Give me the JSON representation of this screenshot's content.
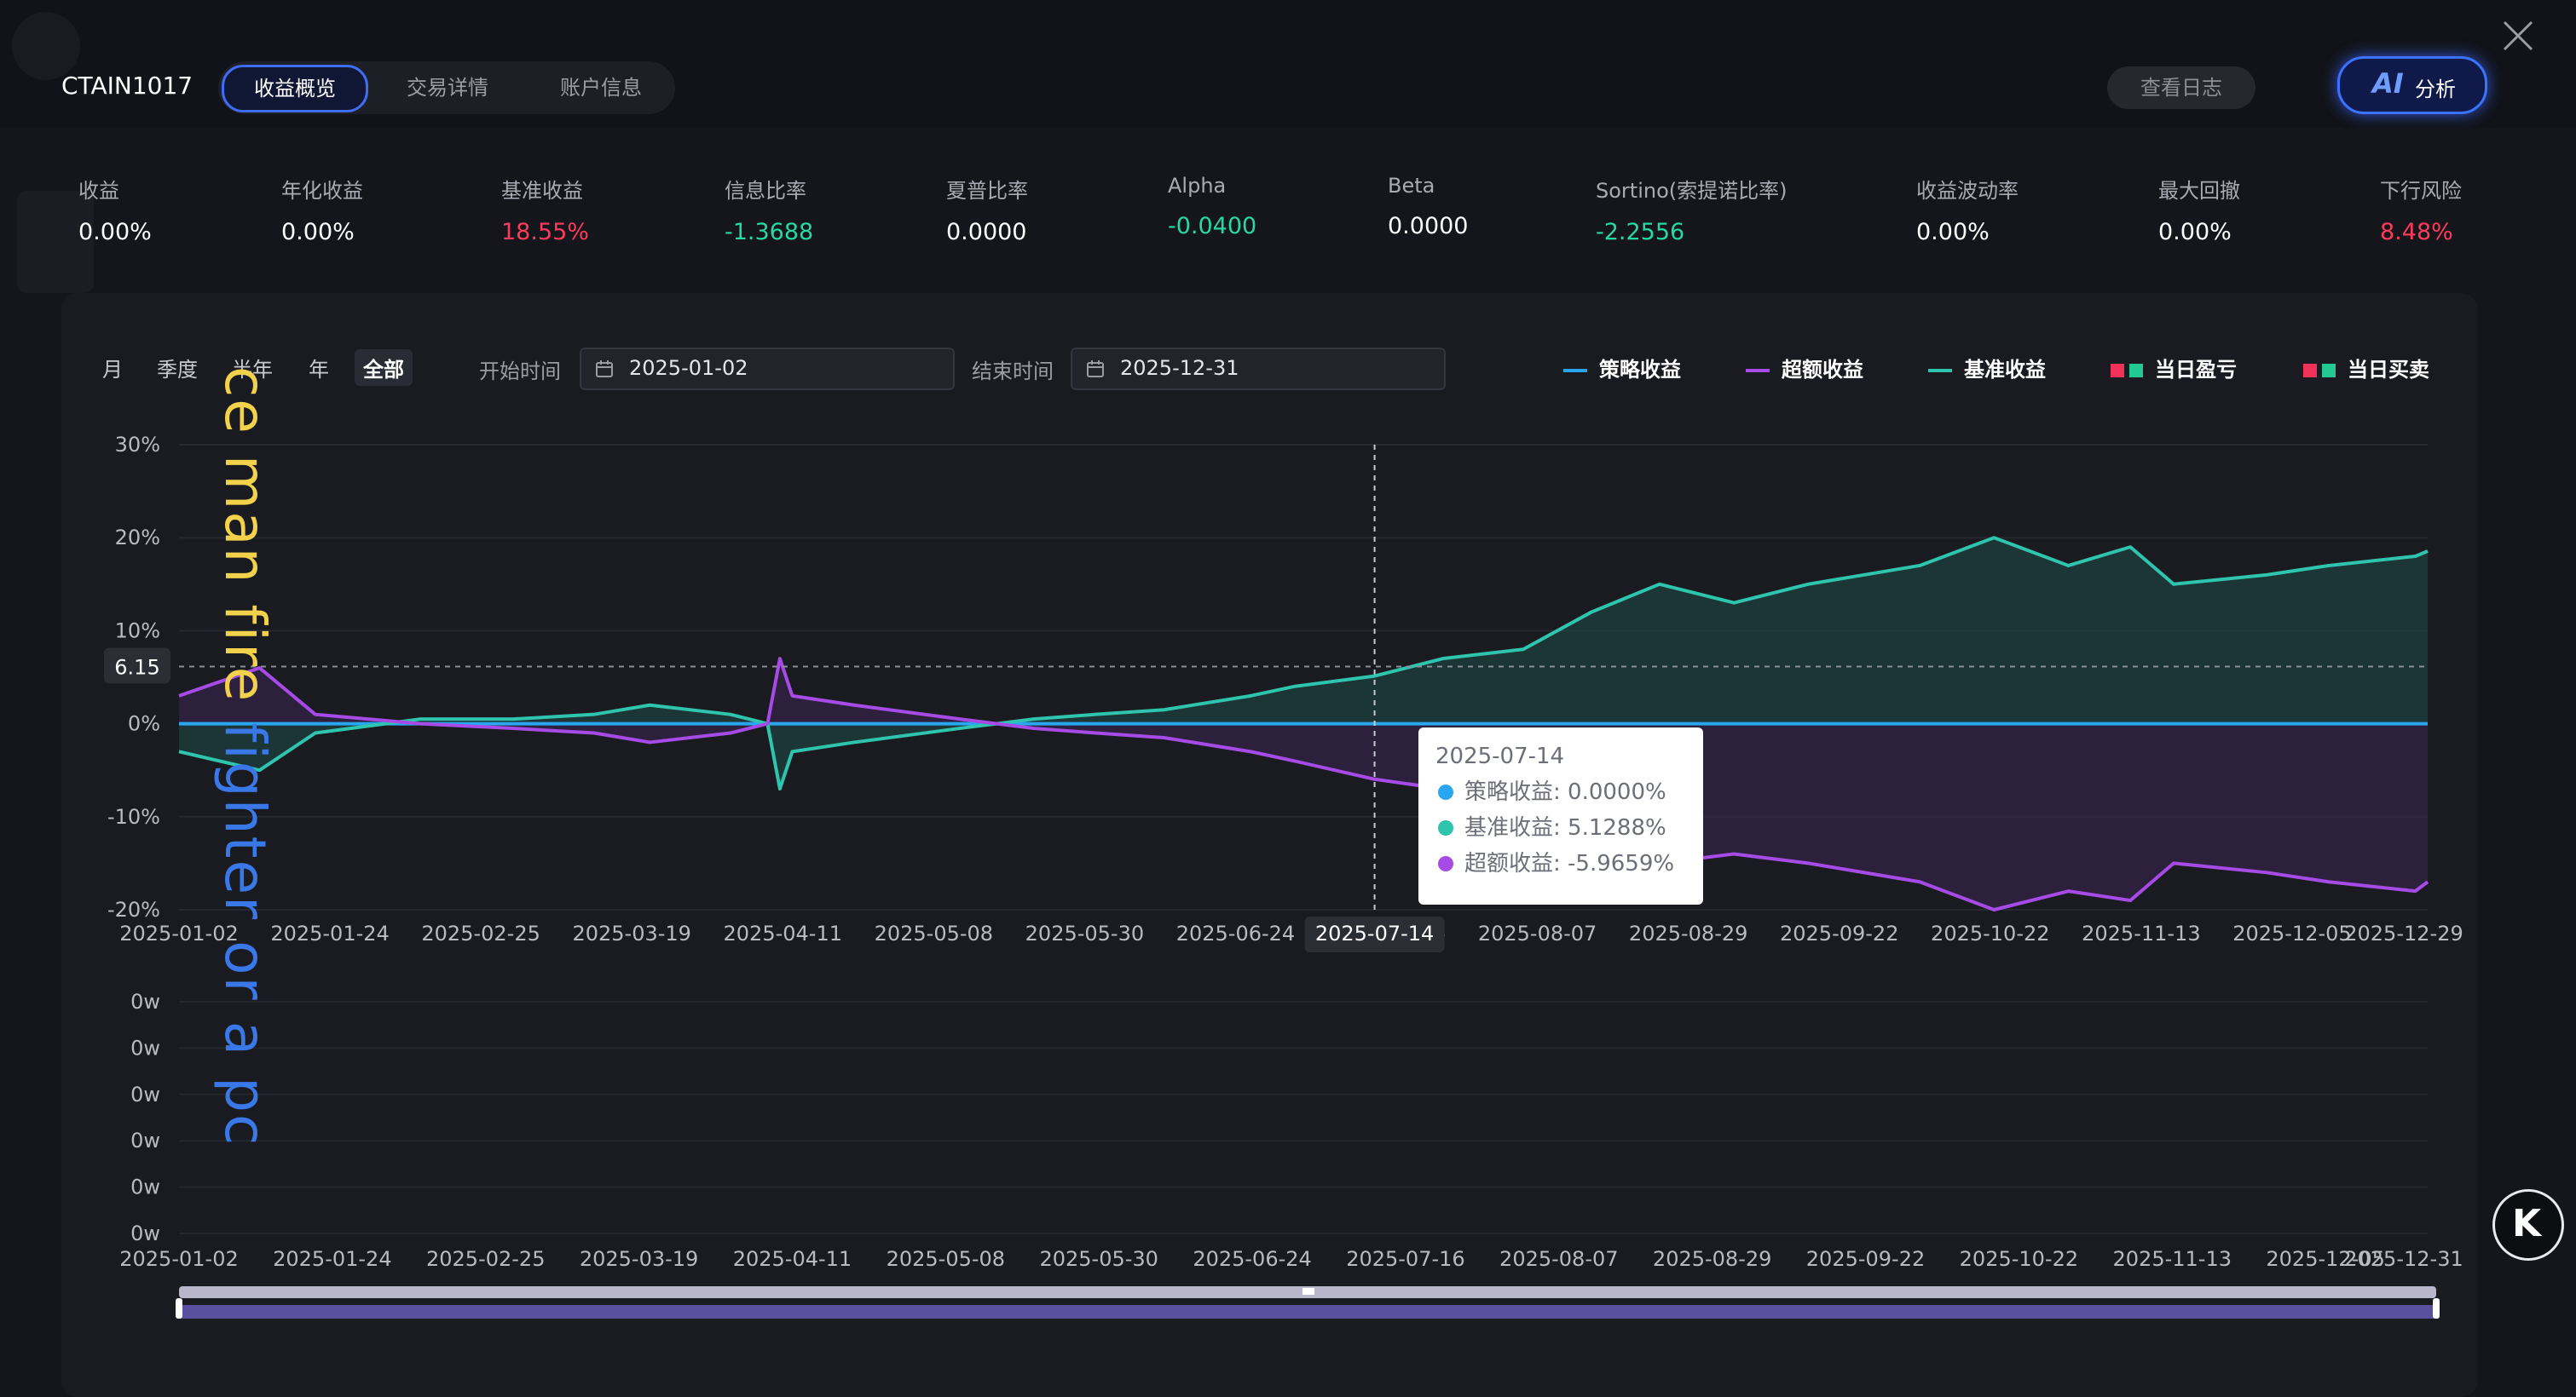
{
  "header": {
    "account_id": "CTAIN1017",
    "tabs": [
      {
        "label": "收益概览",
        "active": true
      },
      {
        "label": "交易详情",
        "active": false
      },
      {
        "label": "账户信息",
        "active": false
      }
    ],
    "log_button": "查看日志",
    "ai_button": {
      "badge": "AI",
      "label": "分析"
    }
  },
  "metrics": [
    {
      "label": "收益",
      "value": "0.00%",
      "tone": "neu"
    },
    {
      "label": "年化收益",
      "value": "0.00%",
      "tone": "neu"
    },
    {
      "label": "基准收益",
      "value": "18.55%",
      "tone": "pos"
    },
    {
      "label": "信息比率",
      "value": "-1.3688",
      "tone": "neg"
    },
    {
      "label": "夏普比率",
      "value": "0.0000",
      "tone": "neu"
    },
    {
      "label": "Alpha",
      "value": "-0.0400",
      "tone": "neg"
    },
    {
      "label": "Beta",
      "value": "0.0000",
      "tone": "neu"
    },
    {
      "label": "Sortino(索提诺比率)",
      "value": "-2.2556",
      "tone": "neg"
    },
    {
      "label": "收益波动率",
      "value": "0.00%",
      "tone": "neu"
    },
    {
      "label": "最大回撤",
      "value": "0.00%",
      "tone": "neu"
    },
    {
      "label": "下行风险",
      "value": "8.48%",
      "tone": "pos"
    }
  ],
  "controls": {
    "periods": [
      {
        "label": "月",
        "active": false
      },
      {
        "label": "季度",
        "active": false
      },
      {
        "label": "半年",
        "active": false
      },
      {
        "label": "年",
        "active": false
      },
      {
        "label": "全部",
        "active": true
      }
    ],
    "start_label": "开始时间",
    "start_value": "2025-01-02",
    "end_label": "结束时间",
    "end_value": "2025-12-31"
  },
  "legend": [
    {
      "label": "策略收益",
      "type": "line",
      "color": "#2aa6f0"
    },
    {
      "label": "超额收益",
      "type": "line",
      "color": "#a64be6"
    },
    {
      "label": "基准收益",
      "type": "line",
      "color": "#2ec4ad"
    },
    {
      "label": "当日盈亏",
      "type": "pair",
      "colors": [
        "#f2315a",
        "#22c993"
      ]
    },
    {
      "label": "当日买卖",
      "type": "pair",
      "colors": [
        "#f2315a",
        "#22c993"
      ]
    }
  ],
  "colors": {
    "strategy": "#2aa6f0",
    "excess": "#a64be6",
    "benchmark": "#2ec4ad",
    "positive": "#ff3a5c",
    "negative": "#27d9a1",
    "accent": "#3e6cf3"
  },
  "watermark": {
    "part1": "ce man fire ",
    "part2": "fighter or a pc"
  },
  "k_logo": "K",
  "chart_data": [
    {
      "type": "line",
      "ylim": [
        -20,
        30
      ],
      "y_ticks": [
        "30%",
        "20%",
        "10%",
        "0%",
        "-10%",
        "-20%"
      ],
      "x_ticks": [
        "2025-01-02",
        "2025-01-24",
        "2025-02-25",
        "2025-03-19",
        "2025-04-11",
        "2025-05-08",
        "2025-05-30",
        "2025-06-24",
        "2025-07-16",
        "2025-08-07",
        "2025-08-29",
        "2025-09-22",
        "2025-10-22",
        "2025-11-13",
        "2025-12-05",
        "2025-12-29"
      ],
      "x_dates": [
        "2025-01-02",
        "2025-01-15",
        "2025-01-24",
        "2025-02-10",
        "2025-02-25",
        "2025-03-10",
        "2025-03-19",
        "2025-04-01",
        "2025-04-07",
        "2025-04-09",
        "2025-04-11",
        "2025-04-21",
        "2025-05-08",
        "2025-05-20",
        "2025-05-30",
        "2025-06-10",
        "2025-06-24",
        "2025-07-01",
        "2025-07-14",
        "2025-07-25",
        "2025-08-07",
        "2025-08-18",
        "2025-08-29",
        "2025-09-10",
        "2025-09-22",
        "2025-10-10",
        "2025-10-22",
        "2025-11-03",
        "2025-11-13",
        "2025-11-20",
        "2025-12-05",
        "2025-12-15",
        "2025-12-29",
        "2025-12-31"
      ],
      "series": [
        {
          "name": "策略收益",
          "values": [
            0,
            0,
            0,
            0,
            0,
            0,
            0,
            0,
            0,
            0,
            0,
            0,
            0,
            0,
            0,
            0,
            0,
            0,
            0,
            0,
            0,
            0,
            0,
            0,
            0,
            0,
            0,
            0,
            0,
            0,
            0,
            0,
            0,
            0
          ]
        },
        {
          "name": "基准收益",
          "values": [
            -3,
            -5,
            -1,
            0.5,
            0.5,
            1,
            2,
            1,
            0,
            -7,
            -3,
            -2,
            -0.5,
            0.5,
            1,
            1.5,
            3,
            4,
            5.13,
            7,
            8,
            12,
            15,
            13,
            15,
            17,
            20,
            17,
            19,
            15,
            16,
            17,
            18,
            18.55
          ]
        },
        {
          "name": "超额收益",
          "values": [
            3,
            6,
            1,
            0,
            -0.5,
            -1,
            -2,
            -1,
            0,
            7,
            3,
            2,
            0.5,
            -0.5,
            -1,
            -1.5,
            -3,
            -4,
            -5.97,
            -7,
            -8,
            -12,
            -15,
            -14,
            -15,
            -17,
            -20,
            -18,
            -19,
            -15,
            -16,
            -17,
            -18,
            -17
          ]
        }
      ],
      "crosshair": {
        "x": "2025-07-14",
        "y_label": "6.15"
      },
      "tooltip": {
        "date": "2025-07-14",
        "rows": [
          {
            "label": "策略收益: 0.0000%",
            "color": "#2aa6f0"
          },
          {
            "label": "基准收益: 5.1288%",
            "color": "#2ec4ad"
          },
          {
            "label": "超额收益: -5.9659%",
            "color": "#a64be6"
          }
        ]
      }
    },
    {
      "type": "bar",
      "y_ticks": [
        "0w",
        "0w",
        "0w",
        "0w",
        "0w",
        "0w"
      ],
      "x_ticks": [
        "2025-01-02",
        "2025-01-24",
        "2025-02-25",
        "2025-03-19",
        "2025-04-11",
        "2025-05-08",
        "2025-05-30",
        "2025-06-24",
        "2025-07-16",
        "2025-08-07",
        "2025-08-29",
        "2025-09-22",
        "2025-10-22",
        "2025-11-13",
        "2025-12-05",
        "2025-12-31"
      ],
      "values": []
    }
  ]
}
